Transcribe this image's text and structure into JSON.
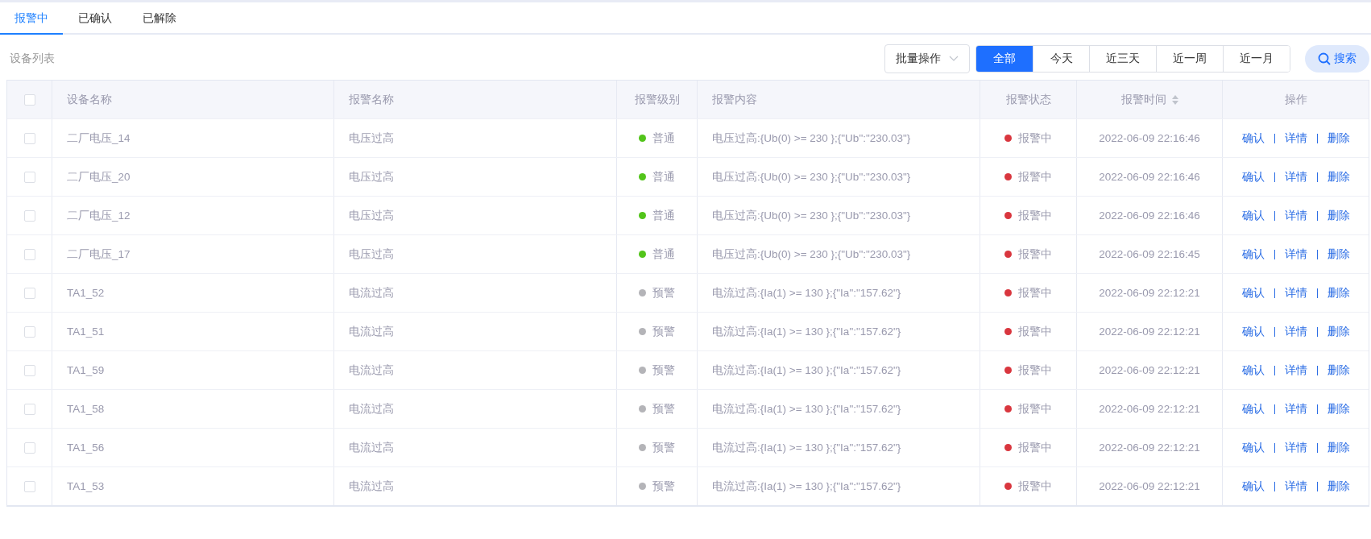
{
  "tabs": [
    {
      "label": "报警中",
      "selected": true
    },
    {
      "label": "已确认",
      "selected": false
    },
    {
      "label": "已解除",
      "selected": false
    }
  ],
  "section_title": "设备列表",
  "batch_dropdown": {
    "label": "批量操作"
  },
  "range_filters": [
    {
      "label": "全部",
      "selected": true
    },
    {
      "label": "今天",
      "selected": false
    },
    {
      "label": "近三天",
      "selected": false
    },
    {
      "label": "近一周",
      "selected": false
    },
    {
      "label": "近一月",
      "selected": false
    }
  ],
  "search_button": {
    "label": "搜索"
  },
  "table": {
    "select_all_checked": false,
    "columns": [
      {
        "label": "设备名称",
        "sortable": false
      },
      {
        "label": "报警名称",
        "sortable": false
      },
      {
        "label": "报警级别",
        "sortable": false
      },
      {
        "label": "报警内容",
        "sortable": false
      },
      {
        "label": "报警状态",
        "sortable": false
      },
      {
        "label": "报警时间",
        "sortable": true
      },
      {
        "label": "操作",
        "sortable": false
      }
    ],
    "rows": [
      {
        "checked": false,
        "device": "二厂电压_14",
        "alarm": "电压过高",
        "level": {
          "label": "普通",
          "color": "#52c41a"
        },
        "content": "电压过高:{Ub(0) >= 230 };{\"Ub\":\"230.03\"}",
        "status": {
          "label": "报警中",
          "color": "#d9363e"
        },
        "time": "2022-06-09 22:16:46",
        "actions": [
          "确认",
          "详情",
          "删除"
        ]
      },
      {
        "checked": false,
        "device": "二厂电压_20",
        "alarm": "电压过高",
        "level": {
          "label": "普通",
          "color": "#52c41a"
        },
        "content": "电压过高:{Ub(0) >= 230 };{\"Ub\":\"230.03\"}",
        "status": {
          "label": "报警中",
          "color": "#d9363e"
        },
        "time": "2022-06-09 22:16:46",
        "actions": [
          "确认",
          "详情",
          "删除"
        ]
      },
      {
        "checked": false,
        "device": "二厂电压_12",
        "alarm": "电压过高",
        "level": {
          "label": "普通",
          "color": "#52c41a"
        },
        "content": "电压过高:{Ub(0) >= 230 };{\"Ub\":\"230.03\"}",
        "status": {
          "label": "报警中",
          "color": "#d9363e"
        },
        "time": "2022-06-09 22:16:46",
        "actions": [
          "确认",
          "详情",
          "删除"
        ]
      },
      {
        "checked": false,
        "device": "二厂电压_17",
        "alarm": "电压过高",
        "level": {
          "label": "普通",
          "color": "#52c41a"
        },
        "content": "电压过高:{Ub(0) >= 230 };{\"Ub\":\"230.03\"}",
        "status": {
          "label": "报警中",
          "color": "#d9363e"
        },
        "time": "2022-06-09 22:16:45",
        "actions": [
          "确认",
          "详情",
          "删除"
        ]
      },
      {
        "checked": false,
        "device": "TA1_52",
        "alarm": "电流过高",
        "level": {
          "label": "预警",
          "color": "#b4b4b8"
        },
        "content": "电流过高:{Ia(1) >= 130 };{\"Ia\":\"157.62\"}",
        "status": {
          "label": "报警中",
          "color": "#d9363e"
        },
        "time": "2022-06-09 22:12:21",
        "actions": [
          "确认",
          "详情",
          "删除"
        ]
      },
      {
        "checked": false,
        "device": "TA1_51",
        "alarm": "电流过高",
        "level": {
          "label": "预警",
          "color": "#b4b4b8"
        },
        "content": "电流过高:{Ia(1) >= 130 };{\"Ia\":\"157.62\"}",
        "status": {
          "label": "报警中",
          "color": "#d9363e"
        },
        "time": "2022-06-09 22:12:21",
        "actions": [
          "确认",
          "详情",
          "删除"
        ]
      },
      {
        "checked": false,
        "device": "TA1_59",
        "alarm": "电流过高",
        "level": {
          "label": "预警",
          "color": "#b4b4b8"
        },
        "content": "电流过高:{Ia(1) >= 130 };{\"Ia\":\"157.62\"}",
        "status": {
          "label": "报警中",
          "color": "#d9363e"
        },
        "time": "2022-06-09 22:12:21",
        "actions": [
          "确认",
          "详情",
          "删除"
        ]
      },
      {
        "checked": false,
        "device": "TA1_58",
        "alarm": "电流过高",
        "level": {
          "label": "预警",
          "color": "#b4b4b8"
        },
        "content": "电流过高:{Ia(1) >= 130 };{\"Ia\":\"157.62\"}",
        "status": {
          "label": "报警中",
          "color": "#d9363e"
        },
        "time": "2022-06-09 22:12:21",
        "actions": [
          "确认",
          "详情",
          "删除"
        ]
      },
      {
        "checked": false,
        "device": "TA1_56",
        "alarm": "电流过高",
        "level": {
          "label": "预警",
          "color": "#b4b4b8"
        },
        "content": "电流过高:{Ia(1) >= 130 };{\"Ia\":\"157.62\"}",
        "status": {
          "label": "报警中",
          "color": "#d9363e"
        },
        "time": "2022-06-09 22:12:21",
        "actions": [
          "确认",
          "详情",
          "删除"
        ]
      },
      {
        "checked": false,
        "device": "TA1_53",
        "alarm": "电流过高",
        "level": {
          "label": "预警",
          "color": "#b4b4b8"
        },
        "content": "电流过高:{Ia(1) >= 130 };{\"Ia\":\"157.62\"}",
        "status": {
          "label": "报警中",
          "color": "#d9363e"
        },
        "time": "2022-06-09 22:12:21",
        "actions": [
          "确认",
          "详情",
          "删除"
        ]
      }
    ]
  }
}
